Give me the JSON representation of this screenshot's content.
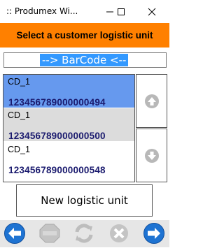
{
  "window": {
    "title": ":: Produmex Wi..."
  },
  "header": {
    "title": "Select a customer logistic unit"
  },
  "barcode": {
    "value": "--> BarCode <--"
  },
  "list": {
    "items": [
      {
        "code": "CD_1",
        "number": "123456789000000494",
        "selected": true
      },
      {
        "code": "CD_1",
        "number": "123456789000000500",
        "selected": false
      },
      {
        "code": "CD_1",
        "number": "123456789000000548",
        "selected": false
      }
    ]
  },
  "actions": {
    "new_logistic_unit": "New logistic unit"
  },
  "colors": {
    "accent": "#ff8000",
    "selection": "#6699ee",
    "alt_row": "#dcdcdc",
    "footer_blue": "#1e73d2"
  },
  "icons": [
    "minimize-icon",
    "maximize-icon",
    "close-icon",
    "up-arrow-icon",
    "down-arrow-icon",
    "back-icon",
    "stop-icon",
    "refresh-icon",
    "cancel-icon",
    "forward-icon"
  ]
}
